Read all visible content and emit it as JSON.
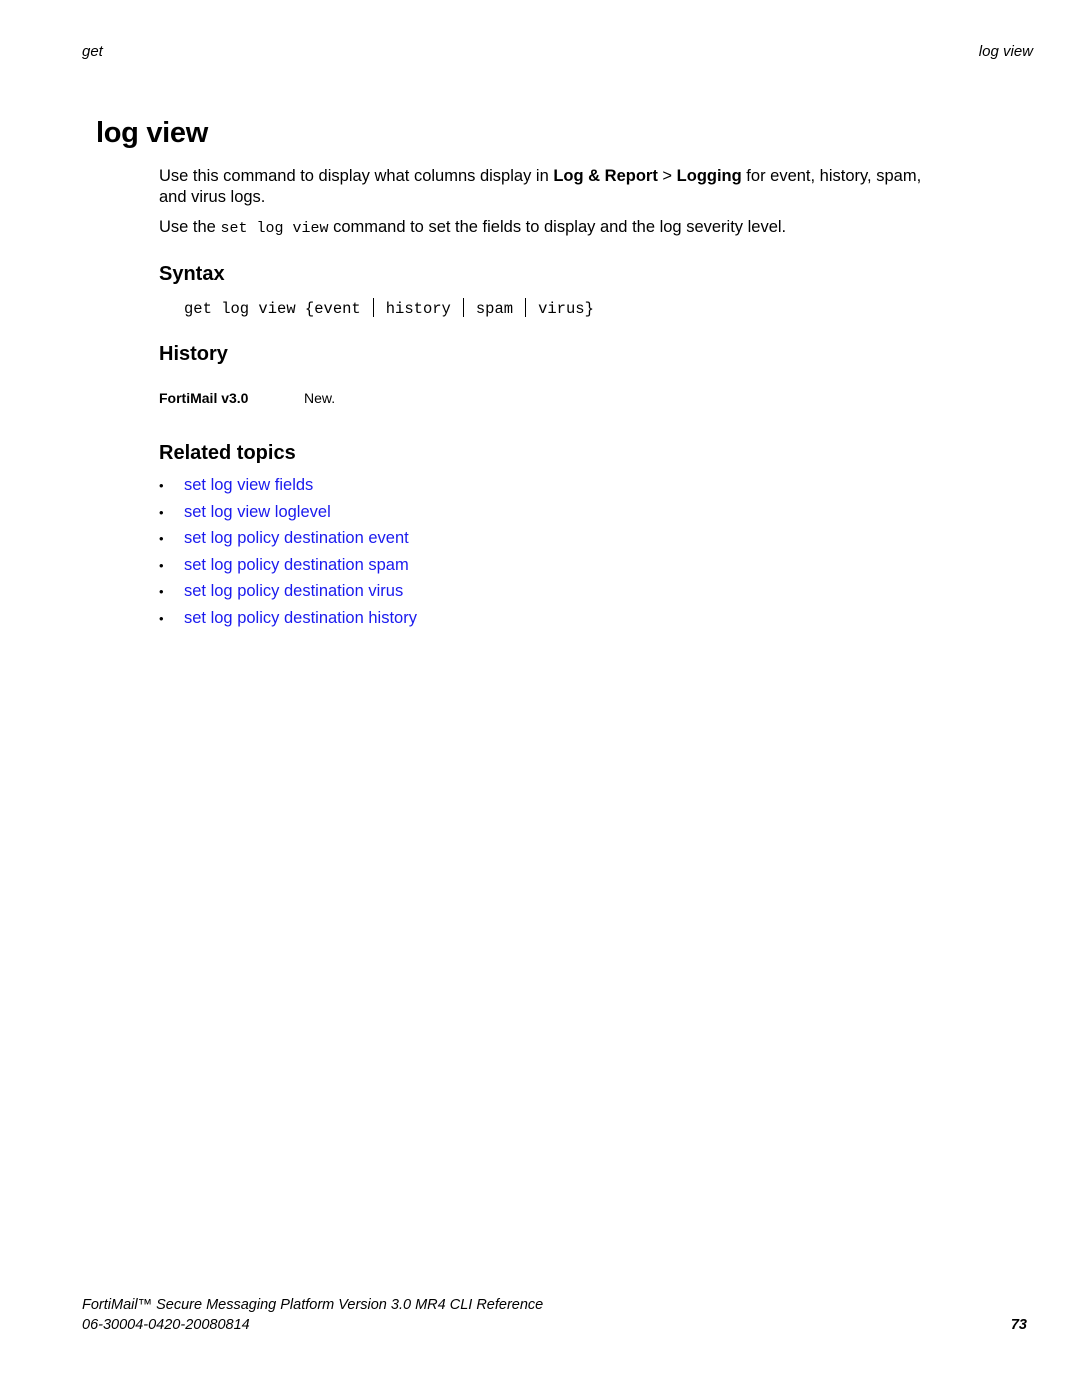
{
  "header": {
    "left": "get",
    "right": "log view"
  },
  "title": "log view",
  "intro": {
    "p1_before": "Use this command to display what columns display in ",
    "p1_bold1": "Log & Report",
    "p1_sep": " > ",
    "p1_bold2": "Logging",
    "p1_after": " for event, history, spam, and virus logs.",
    "p2_before": "Use the ",
    "p2_code": "set log view",
    "p2_after": " command to set the fields to display and the log severity level."
  },
  "syntax": {
    "heading": "Syntax",
    "prefix": "get log view {event",
    "options": [
      "history",
      "spam",
      "virus}"
    ]
  },
  "history": {
    "heading": "History",
    "version": "FortiMail v3.0",
    "note": "New."
  },
  "related": {
    "heading": "Related topics",
    "bullet": "•",
    "links": [
      "set log view fields",
      "set log view loglevel",
      "set log policy destination event",
      "set log policy destination spam",
      "set log policy destination virus",
      "set log policy destination history"
    ]
  },
  "footer": {
    "title": "FortiMail™ Secure Messaging Platform Version 3.0 MR4 CLI Reference",
    "doc_code": "06-30004-0420-20080814",
    "page_number": "73"
  },
  "colors": {
    "link": "#1a1aee",
    "text": "#000000"
  }
}
